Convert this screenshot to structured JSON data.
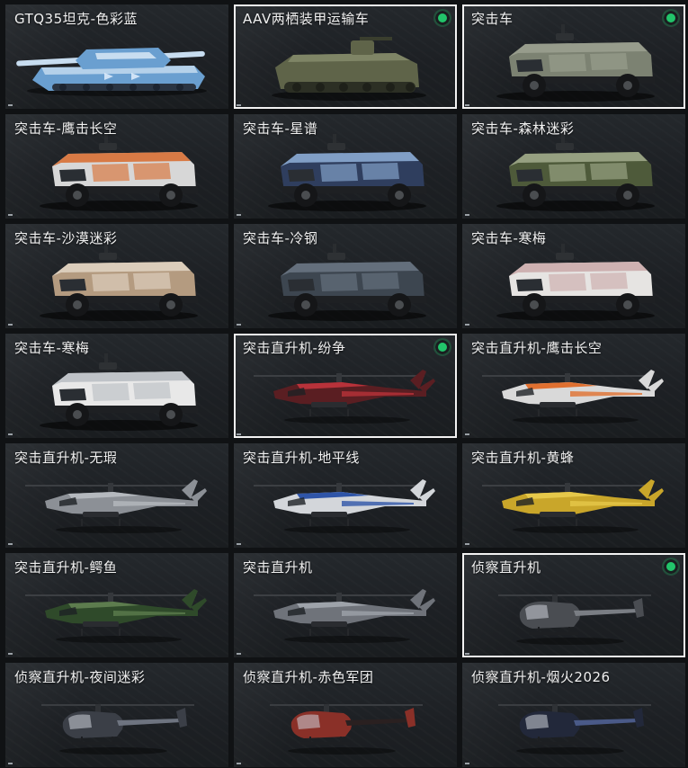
{
  "items": [
    {
      "name": "GTQ35坦克-色彩蓝",
      "type": "tank",
      "c1": "#6a9fd0",
      "c2": "#c8ddf0",
      "selected": false,
      "equipped": false
    },
    {
      "name": "AAV两栖装甲运输车",
      "type": "aav",
      "c1": "#5f6449",
      "c2": "#7f8566",
      "selected": true,
      "equipped": true
    },
    {
      "name": "突击车",
      "type": "truck",
      "c1": "#7c8272",
      "c2": "#9ca191",
      "selected": true,
      "equipped": true
    },
    {
      "name": "突击车-鹰击长空",
      "type": "truck",
      "c1": "#d7d7d7",
      "c2": "#d86a2c",
      "selected": false,
      "equipped": false
    },
    {
      "name": "突击车-星谱",
      "type": "truck",
      "c1": "#2f3e5e",
      "c2": "#8fb0d8",
      "selected": false,
      "equipped": false
    },
    {
      "name": "突击车-森林迷彩",
      "type": "truck",
      "c1": "#4e5a3a",
      "c2": "#a3ad8e",
      "selected": false,
      "equipped": false
    },
    {
      "name": "突击车-沙漠迷彩",
      "type": "truck",
      "c1": "#b49b80",
      "c2": "#e2d6c6",
      "selected": false,
      "equipped": false
    },
    {
      "name": "突击车-冷钢",
      "type": "truck",
      "c1": "#3d4650",
      "c2": "#6b7784",
      "selected": false,
      "equipped": false
    },
    {
      "name": "突击车-寒梅",
      "type": "truck",
      "c1": "#e6e4e2",
      "c2": "#c9a8a8",
      "selected": false,
      "equipped": false
    },
    {
      "name": "突击车-寒梅",
      "type": "truck",
      "c1": "#e8e8e8",
      "c2": "#b7bcc2",
      "selected": false,
      "equipped": false
    },
    {
      "name": "突击直升机-纷争",
      "type": "heli",
      "c1": "#5a1e22",
      "c2": "#b8323a",
      "selected": true,
      "equipped": true
    },
    {
      "name": "突击直升机-鹰击长空",
      "type": "heli",
      "c1": "#d9d9d9",
      "c2": "#e07030",
      "selected": false,
      "equipped": false
    },
    {
      "name": "突击直升机-无瑕",
      "type": "heli",
      "c1": "#8c9096",
      "c2": "#b5b9be",
      "selected": false,
      "equipped": false
    },
    {
      "name": "突击直升机-地平线",
      "type": "heli",
      "c1": "#d3d6da",
      "c2": "#2f55a8",
      "selected": false,
      "equipped": false
    },
    {
      "name": "突击直升机-黄蜂",
      "type": "heli",
      "c1": "#c9a62a",
      "c2": "#e6c84a",
      "selected": false,
      "equipped": false
    },
    {
      "name": "突击直升机-鳄鱼",
      "type": "heli",
      "c1": "#2f4a2a",
      "c2": "#5d7c4e",
      "selected": false,
      "equipped": false
    },
    {
      "name": "突击直升机",
      "type": "heli",
      "c1": "#6f737a",
      "c2": "#9ea3aa",
      "selected": false,
      "equipped": false
    },
    {
      "name": "侦察直升机",
      "type": "scout",
      "c1": "#4a4d52",
      "c2": "#7a7e84",
      "selected": true,
      "equipped": true
    },
    {
      "name": "侦察直升机-夜间迷彩",
      "type": "scout",
      "c1": "#3b3f47",
      "c2": "#6e7480",
      "selected": false,
      "equipped": false
    },
    {
      "name": "侦察直升机-赤色军团",
      "type": "scout",
      "c1": "#8a3028",
      "c2": "#2a2020",
      "selected": false,
      "equipped": false
    },
    {
      "name": "侦察直升机-烟火2026",
      "type": "scout",
      "c1": "#22283a",
      "c2": "#4a5a88",
      "selected": false,
      "equipped": false
    }
  ]
}
